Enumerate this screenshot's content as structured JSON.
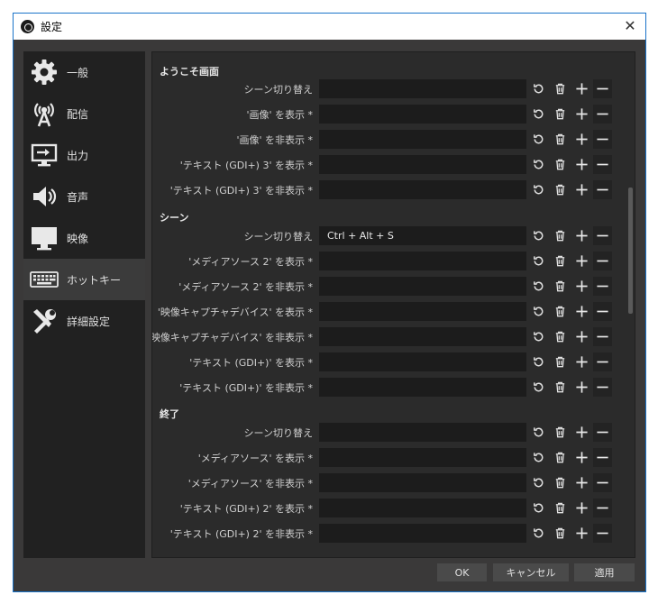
{
  "window": {
    "title": "設定"
  },
  "sidebar": {
    "items": [
      {
        "label": "一般",
        "icon": "gear-icon"
      },
      {
        "label": "配信",
        "icon": "broadcast-antenna-icon"
      },
      {
        "label": "出力",
        "icon": "output-monitor-icon"
      },
      {
        "label": "音声",
        "icon": "speaker-icon"
      },
      {
        "label": "映像",
        "icon": "monitor-icon"
      },
      {
        "label": "ホットキー",
        "icon": "keyboard-icon",
        "active": true
      },
      {
        "label": "詳細設定",
        "icon": "tools-icon"
      }
    ]
  },
  "sections": [
    {
      "title": "ようこそ画面",
      "rows": [
        {
          "label": "シーン切り替え",
          "value": ""
        },
        {
          "label": "'画像' を表示 *",
          "value": ""
        },
        {
          "label": "'画像' を非表示 *",
          "value": ""
        },
        {
          "label": "'テキスト (GDI+) 3' を表示 *",
          "value": ""
        },
        {
          "label": "'テキスト (GDI+) 3' を非表示 *",
          "value": ""
        }
      ]
    },
    {
      "title": "シーン",
      "rows": [
        {
          "label": "シーン切り替え",
          "value": "Ctrl + Alt + S"
        },
        {
          "label": "'メディアソース 2' を表示 *",
          "value": ""
        },
        {
          "label": "'メディアソース 2' を非表示 *",
          "value": ""
        },
        {
          "label": "'映像キャプチャデバイス' を表示 *",
          "value": ""
        },
        {
          "label": "'映像キャプチャデバイス' を非表示 *",
          "value": ""
        },
        {
          "label": "'テキスト (GDI+)' を表示 *",
          "value": ""
        },
        {
          "label": "'テキスト (GDI+)' を非表示 *",
          "value": ""
        }
      ]
    },
    {
      "title": "終了",
      "rows": [
        {
          "label": "シーン切り替え",
          "value": ""
        },
        {
          "label": "'メディアソース' を表示 *",
          "value": ""
        },
        {
          "label": "'メディアソース' を非表示 *",
          "value": ""
        },
        {
          "label": "'テキスト (GDI+) 2' を表示 *",
          "value": ""
        },
        {
          "label": "'テキスト (GDI+) 2' を非表示 *",
          "value": ""
        }
      ]
    }
  ],
  "footer": {
    "ok": "OK",
    "cancel": "キャンセル",
    "apply": "適用"
  }
}
